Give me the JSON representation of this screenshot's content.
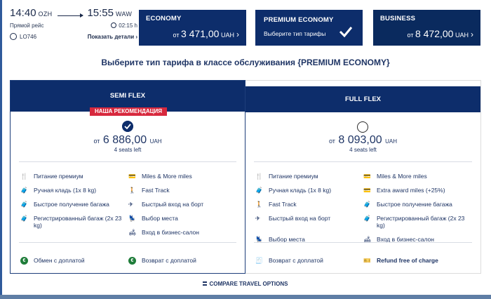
{
  "flight": {
    "dep_time": "14:40",
    "dep_code": "OZH",
    "arr_time": "15:55",
    "arr_code": "WAW",
    "direct": "Прямой рейс",
    "duration": "02:15 h",
    "flight_no": "LO746",
    "details": "Показать детали ›"
  },
  "tabs": {
    "economy": {
      "name": "ECONOMY",
      "from": "от",
      "amount": "3 471,00",
      "currency": "UAH"
    },
    "premium": {
      "name": "PREMIUM ECONOMY",
      "sub": "Выберите тип тарифы"
    },
    "business": {
      "name": "BUSINESS",
      "from": "от",
      "amount": "8 472,00",
      "currency": "UAH"
    }
  },
  "headline": "Выберите тип тарифа в классе обслуживания {PREMIUM ECONOMY}",
  "semi": {
    "title": "SEMI FLEX",
    "recommend": "НАША РЕКОМЕНДАЦИЯ",
    "from": "от",
    "amount": "6 886,00",
    "currency": "UAH",
    "seats": "4 seats left",
    "left_features": [
      "Питание премиум",
      "Ручная кладь (1x 8 kg)",
      "Быстрое получение багажа",
      "Регистрированный багаж (2x 23 kg)"
    ],
    "right_features": [
      "Miles & More miles",
      "Fast Track",
      "Быстрый вход на борт",
      "Выбор места",
      "Вход в бизнес-салон"
    ],
    "extra_left": "Обмен с доплатой",
    "extra_right": "Возврат с доплатой"
  },
  "full": {
    "title": "FULL FLEX",
    "from": "от",
    "amount": "8 093,00",
    "currency": "UAH",
    "seats": "4 seats left",
    "left_features": [
      "Питание премиум",
      "Ручная кладь (1x 8 kg)",
      "Fast Track",
      "Быстрый вход на борт",
      "Выбор места"
    ],
    "right_features": [
      "Miles & More miles",
      "Extra award miles (+25%)",
      "Быстрое получение багажа",
      "Регистрированный багаж (2x 23 kg)",
      "Вход в бизнес-салон"
    ],
    "extra_left": "Возврат с доплатой",
    "extra_right": "Refund free of charge"
  },
  "compare": "COMPARE TRAVEL OPTIONS",
  "colors": {
    "navy": "#0d2d6b",
    "red": "#d7283d",
    "green": "#1f7d3a"
  }
}
